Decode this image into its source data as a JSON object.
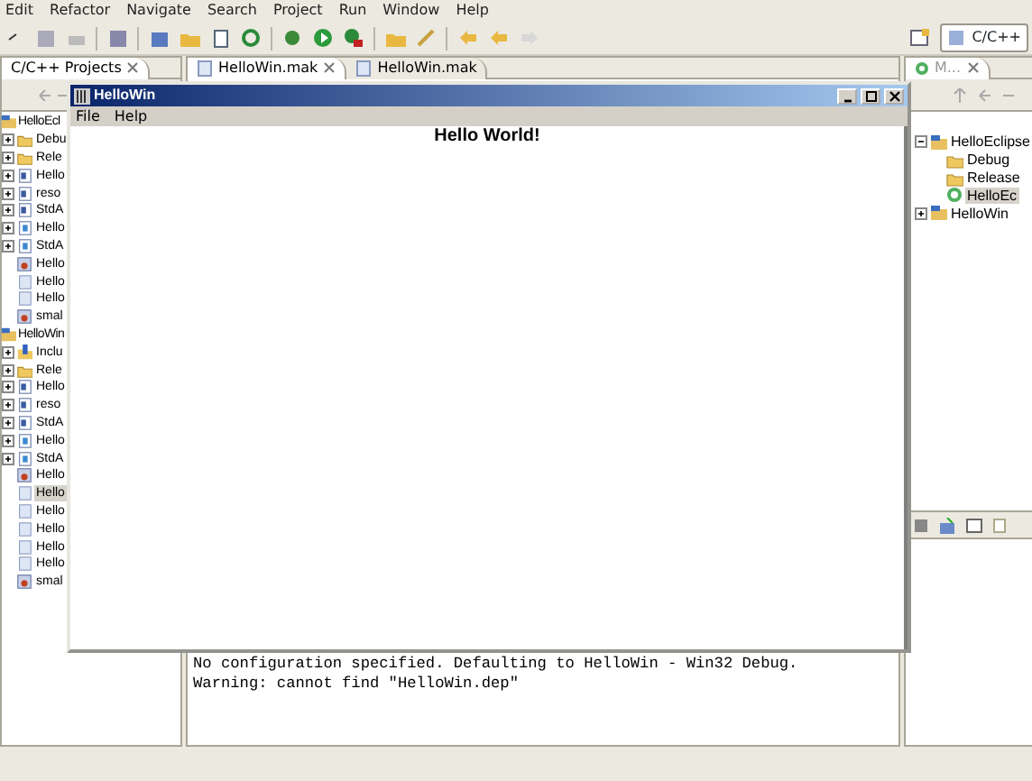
{
  "menu": [
    "Edit",
    "Refactor",
    "Navigate",
    "Search",
    "Project",
    "Run",
    "Window",
    "Help"
  ],
  "perspective": {
    "label": "C/C++",
    "selected": true
  },
  "projects_view": {
    "title": "C/C++ Projects",
    "tree": [
      {
        "label": "HelloEcl",
        "kind": "project",
        "selected": false,
        "children": [
          {
            "label": "Debu",
            "kind": "folder",
            "expanded": false,
            "selected": false
          },
          {
            "label": "Rele",
            "kind": "folder",
            "expanded": false,
            "selected": false
          },
          {
            "label": "Hello",
            "kind": "header",
            "expanded": false,
            "selected": false
          },
          {
            "label": "reso",
            "kind": "header",
            "expanded": false,
            "selected": false
          },
          {
            "label": "StdA",
            "kind": "header",
            "expanded": false,
            "selected": false
          },
          {
            "label": "Hello",
            "kind": "source",
            "expanded": false,
            "selected": false
          },
          {
            "label": "StdA",
            "kind": "source",
            "expanded": false,
            "selected": false
          },
          {
            "label": "Hello",
            "kind": "image",
            "selected": false
          },
          {
            "label": "Hello",
            "kind": "file",
            "selected": false
          },
          {
            "label": "Hello",
            "kind": "file",
            "selected": false
          },
          {
            "label": "smal",
            "kind": "image",
            "selected": false
          }
        ]
      },
      {
        "label": "HelloWin",
        "kind": "project",
        "selected": false,
        "children": [
          {
            "label": "Inclu",
            "kind": "includes",
            "expanded": false,
            "selected": false
          },
          {
            "label": "Rele",
            "kind": "folder",
            "expanded": false,
            "selected": false
          },
          {
            "label": "Hello",
            "kind": "header",
            "expanded": false,
            "selected": false
          },
          {
            "label": "reso",
            "kind": "header",
            "expanded": false,
            "selected": false
          },
          {
            "label": "StdA",
            "kind": "header",
            "expanded": false,
            "selected": false
          },
          {
            "label": "Hello",
            "kind": "source",
            "expanded": false,
            "selected": false
          },
          {
            "label": "StdA",
            "kind": "source",
            "expanded": false,
            "selected": false
          },
          {
            "label": "Hello",
            "kind": "image",
            "selected": false
          },
          {
            "label": "Hello",
            "kind": "file",
            "selected": true
          },
          {
            "label": "Hello",
            "kind": "file",
            "selected": false
          },
          {
            "label": "Hello",
            "kind": "file",
            "selected": false
          },
          {
            "label": "Hello",
            "kind": "file",
            "selected": false
          },
          {
            "label": "Hello",
            "kind": "file",
            "selected": false
          },
          {
            "label": "smal",
            "kind": "image",
            "selected": false
          }
        ]
      }
    ]
  },
  "editor_tabs": [
    {
      "label": "HelloWin.mak",
      "selected": true,
      "closable": true
    },
    {
      "label": "HelloWin.mak",
      "selected": false,
      "closable": false
    }
  ],
  "console": {
    "lines": [
      "No configuration specified. Defaulting to HelloWin - Win32 Debug.",
      "Warning: cannot find \"HelloWin.dep\""
    ]
  },
  "make_view": {
    "title": "M...",
    "tree": [
      {
        "label": "HelloEclipse",
        "kind": "project",
        "expanded": true,
        "selected": false,
        "children": [
          {
            "label": "Debug",
            "kind": "folder",
            "selected": false
          },
          {
            "label": "Release",
            "kind": "folder",
            "selected": false
          },
          {
            "label": "HelloEc",
            "kind": "target",
            "selected": true
          }
        ]
      },
      {
        "label": "HelloWin",
        "kind": "project",
        "expanded": false,
        "selected": false
      }
    ]
  },
  "app_window": {
    "title": "HelloWin",
    "menu": [
      "File",
      "Help"
    ],
    "content": "Hello World!"
  }
}
